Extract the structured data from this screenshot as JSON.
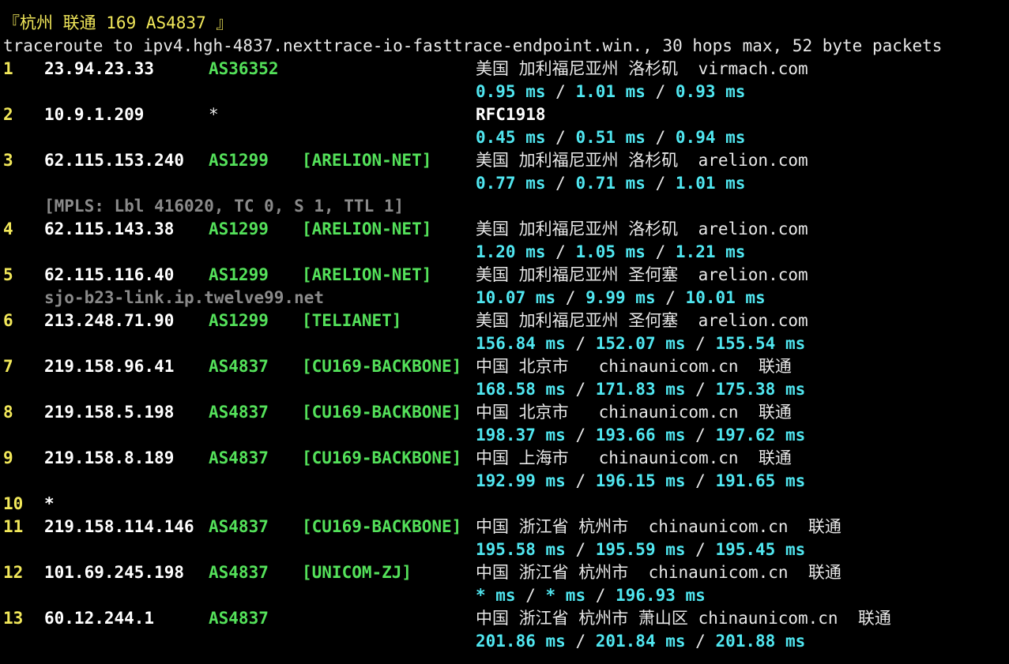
{
  "header": {
    "title": "『杭州 联通 169 AS4837 』",
    "command_line": "traceroute to ipv4.hgh-4837.nexttrace-io-fasttrace-endpoint.win., 30 hops max, 52 byte packets"
  },
  "hops": [
    {
      "num": "1",
      "ip": "23.94.23.33",
      "as": "AS36352",
      "net": "",
      "geo": "美国 加利福尼亚州 洛杉矶  virmach.com",
      "lat": [
        "0.95 ms",
        "1.01 ms",
        "0.93 ms"
      ],
      "hostname": "",
      "mpls": ""
    },
    {
      "num": "2",
      "ip": "10.9.1.209",
      "as": "*",
      "net": "",
      "geo": "RFC1918",
      "lat": [
        "0.45 ms",
        "0.51 ms",
        "0.94 ms"
      ],
      "hostname": "",
      "mpls": ""
    },
    {
      "num": "3",
      "ip": "62.115.153.240",
      "as": "AS1299",
      "net": "[ARELION-NET]",
      "geo": "美国 加利福尼亚州 洛杉矶  arelion.com",
      "lat": [
        "0.77 ms",
        "0.71 ms",
        "1.01 ms"
      ],
      "hostname": "",
      "mpls": ""
    },
    {
      "num": "4",
      "ip": "62.115.143.38",
      "as": "AS1299",
      "net": "[ARELION-NET]",
      "geo": "美国 加利福尼亚州 洛杉矶  arelion.com",
      "lat": [
        "1.20 ms",
        "1.05 ms",
        "1.21 ms"
      ],
      "hostname": "",
      "mpls": "[MPLS: Lbl 416020, TC 0, S 1, TTL 1]"
    },
    {
      "num": "5",
      "ip": "62.115.116.40",
      "as": "AS1299",
      "net": "[ARELION-NET]",
      "geo": "美国 加利福尼亚州 圣何塞  arelion.com",
      "lat": [
        "10.07 ms",
        "9.99 ms",
        "10.01 ms"
      ],
      "hostname": "sjo-b23-link.ip.twelve99.net",
      "mpls": ""
    },
    {
      "num": "6",
      "ip": "213.248.71.90",
      "as": "AS1299",
      "net": "[TELIANET]",
      "geo": "美国 加利福尼亚州 圣何塞  arelion.com",
      "lat": [
        "156.84 ms",
        "152.07 ms",
        "155.54 ms"
      ],
      "hostname": "",
      "mpls": ""
    },
    {
      "num": "7",
      "ip": "219.158.96.41",
      "as": "AS4837",
      "net": "[CU169-BACKBONE]",
      "geo": "中国 北京市   chinaunicom.cn  联通",
      "lat": [
        "168.58 ms",
        "171.83 ms",
        "175.38 ms"
      ],
      "hostname": "",
      "mpls": ""
    },
    {
      "num": "8",
      "ip": "219.158.5.198",
      "as": "AS4837",
      "net": "[CU169-BACKBONE]",
      "geo": "中国 北京市   chinaunicom.cn  联通",
      "lat": [
        "198.37 ms",
        "193.66 ms",
        "197.62 ms"
      ],
      "hostname": "",
      "mpls": ""
    },
    {
      "num": "9",
      "ip": "219.158.8.189",
      "as": "AS4837",
      "net": "[CU169-BACKBONE]",
      "geo": "中国 上海市   chinaunicom.cn  联通",
      "lat": [
        "192.99 ms",
        "196.15 ms",
        "191.65 ms"
      ],
      "hostname": "",
      "mpls": ""
    },
    {
      "num": "10",
      "ip": "*",
      "as": "",
      "net": "",
      "geo": "",
      "lat": [],
      "hostname": "",
      "mpls": ""
    },
    {
      "num": "11",
      "ip": "219.158.114.146",
      "as": "AS4837",
      "net": "[CU169-BACKBONE]",
      "geo": "中国 浙江省 杭州市  chinaunicom.cn  联通",
      "lat": [
        "195.58 ms",
        "195.59 ms",
        "195.45 ms"
      ],
      "hostname": "",
      "mpls": ""
    },
    {
      "num": "12",
      "ip": "101.69.245.198",
      "as": "AS4837",
      "net": "[UNICOM-ZJ]",
      "geo": "中国 浙江省 杭州市  chinaunicom.cn  联通",
      "lat": [
        "* ms",
        "* ms",
        "196.93 ms"
      ],
      "hostname": "",
      "mpls": ""
    },
    {
      "num": "13",
      "ip": "60.12.244.1",
      "as": "AS4837",
      "net": "",
      "geo": "中国 浙江省 杭州市 萧山区 chinaunicom.cn  联通",
      "lat": [
        "201.86 ms",
        "201.84 ms",
        "201.88 ms"
      ],
      "hostname": "",
      "mpls": ""
    }
  ],
  "colors": {
    "background": "#000000",
    "hop_number": "#f2e85a",
    "asn": "#54e15a",
    "latency": "#50e6f0",
    "muted": "#8a8a8a"
  }
}
